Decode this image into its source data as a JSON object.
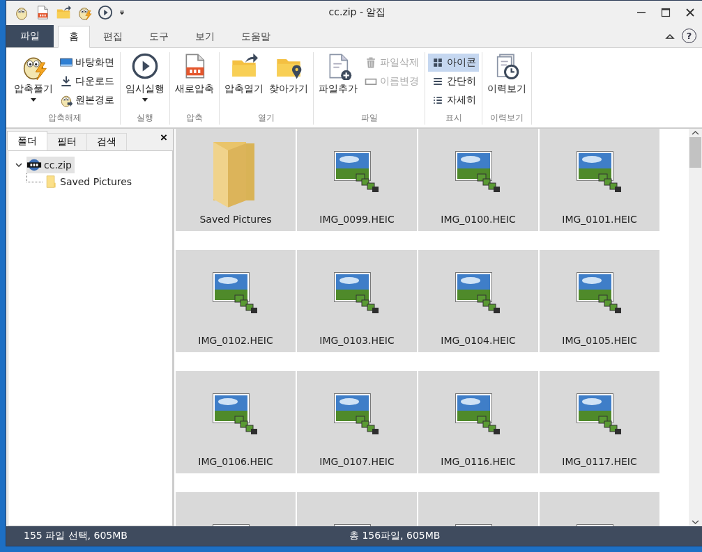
{
  "window": {
    "title": "cc.zip - 알집"
  },
  "quick_access": [
    {
      "kind": "button"
    },
    {
      "kind": "button"
    },
    {
      "kind": "button"
    },
    {
      "kind": "button"
    },
    {
      "kind": "button"
    },
    {
      "kind": "menu"
    }
  ],
  "menu_tabs": [
    {
      "label": "파일",
      "kind": "file",
      "selected": false
    },
    {
      "label": "홈",
      "kind": "tab",
      "selected": true
    },
    {
      "label": "편집",
      "kind": "tab",
      "selected": false
    },
    {
      "label": "도구",
      "kind": "tab",
      "selected": false
    },
    {
      "label": "보기",
      "kind": "tab",
      "selected": false
    },
    {
      "label": "도움말",
      "kind": "tab",
      "selected": false
    }
  ],
  "help_button": "?",
  "ribbon": [
    {
      "label": "압축해제",
      "items": [
        {
          "kind": "large",
          "label": "압축풀기",
          "dropdown": true
        },
        {
          "kind": "small",
          "label": "바탕화면",
          "disabled": false
        },
        {
          "kind": "small",
          "label": "다운로드",
          "disabled": false
        },
        {
          "kind": "small",
          "label": "원본경로",
          "disabled": false
        }
      ]
    },
    {
      "label": "실행",
      "items": [
        {
          "kind": "large",
          "label": "임시실행",
          "dropdown": true
        }
      ]
    },
    {
      "label": "압축",
      "items": [
        {
          "kind": "large",
          "label": "새로압축",
          "dropdown": false
        }
      ]
    },
    {
      "label": "열기",
      "items": [
        {
          "kind": "large",
          "label": "압축열기",
          "dropdown": false
        },
        {
          "kind": "large",
          "label": "찾아가기",
          "dropdown": false
        }
      ]
    },
    {
      "label": "파일",
      "items": [
        {
          "kind": "large",
          "label": "파일추가",
          "dropdown": false
        },
        {
          "kind": "small",
          "label": "파일삭제",
          "disabled": true
        },
        {
          "kind": "small",
          "label": "이름변경",
          "disabled": true
        }
      ]
    },
    {
      "label": "표시",
      "items": [
        {
          "kind": "view",
          "label": "아이콘",
          "selected": true
        },
        {
          "kind": "view",
          "label": "간단히",
          "selected": false
        },
        {
          "kind": "view",
          "label": "자세히",
          "selected": false
        }
      ]
    },
    {
      "label": "이력보기",
      "items": [
        {
          "kind": "large",
          "label": "이력보기",
          "dropdown": false
        }
      ]
    }
  ],
  "side_panel": {
    "tabs": [
      {
        "label": "폴더",
        "selected": true
      },
      {
        "label": "필터",
        "selected": false
      },
      {
        "label": "검색",
        "selected": false
      }
    ],
    "close": "×",
    "tree": [
      {
        "label": "cc.zip",
        "expanded": true,
        "selected": true,
        "children": [
          {
            "label": "Saved Pictures",
            "selected": false
          }
        ]
      }
    ]
  },
  "files": [
    {
      "name": "Saved Pictures",
      "kind": "folder",
      "selected": true
    },
    {
      "name": "IMG_0099.HEIC",
      "kind": "image",
      "selected": true
    },
    {
      "name": "IMG_0100.HEIC",
      "kind": "image",
      "selected": true
    },
    {
      "name": "IMG_0101.HEIC",
      "kind": "image",
      "selected": true
    },
    {
      "name": "IMG_0102.HEIC",
      "kind": "image",
      "selected": true
    },
    {
      "name": "IMG_0103.HEIC",
      "kind": "image",
      "selected": true
    },
    {
      "name": "IMG_0104.HEIC",
      "kind": "image",
      "selected": true
    },
    {
      "name": "IMG_0105.HEIC",
      "kind": "image",
      "selected": true
    },
    {
      "name": "IMG_0106.HEIC",
      "kind": "image",
      "selected": true
    },
    {
      "name": "IMG_0107.HEIC",
      "kind": "image",
      "selected": true
    },
    {
      "name": "IMG_0116.HEIC",
      "kind": "image",
      "selected": true
    },
    {
      "name": "IMG_0117.HEIC",
      "kind": "image",
      "selected": true
    },
    {
      "kind": "image",
      "selected": true
    },
    {
      "kind": "image",
      "selected": true
    },
    {
      "kind": "image",
      "selected": true
    },
    {
      "kind": "image",
      "selected": true
    }
  ],
  "status_bar": {
    "selection": "155 파일 선택,  605MB",
    "total": "총 156파일,  605MB"
  }
}
